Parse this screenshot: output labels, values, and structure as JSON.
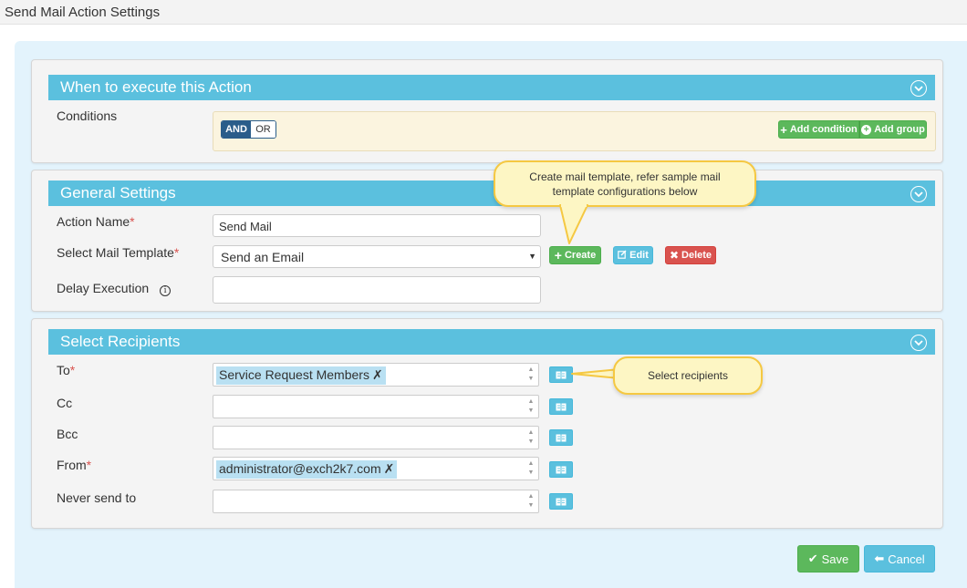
{
  "page": {
    "title": "Send Mail Action Settings"
  },
  "sections": {
    "when": {
      "title": "When to execute this Action",
      "conditions_label": "Conditions",
      "and_label": "AND",
      "or_label": "OR",
      "add_condition": "Add condition",
      "add_group": "Add group"
    },
    "general": {
      "title": "General Settings",
      "action_name_label": "Action Name",
      "action_name_value": "Send Mail",
      "template_label": "Select Mail Template",
      "template_value": "Send an Email",
      "create": "Create",
      "edit": "Edit",
      "delete": "Delete",
      "delay_label": "Delay Execution",
      "delay_value": ""
    },
    "recipients": {
      "title": "Select Recipients",
      "to_label": "To",
      "to_tag": "Service Request Members",
      "cc_label": "Cc",
      "bcc_label": "Bcc",
      "from_label": "From",
      "from_tag": "administrator@exch2k7.com",
      "never_label": "Never send to"
    }
  },
  "callouts": {
    "template": "Create mail template, refer sample mail template configurations below",
    "recipients": "Select recipients"
  },
  "footer": {
    "save": "Save",
    "cancel": "Cancel"
  },
  "required_mark": "*",
  "tag_remove": "✗",
  "colors": {
    "header": "#5bc0de",
    "success": "#5cb85c",
    "danger": "#d9534f",
    "and_active": "#2a5d8a",
    "callout_bg": "#fdf6c4",
    "callout_border": "#f5c842"
  }
}
